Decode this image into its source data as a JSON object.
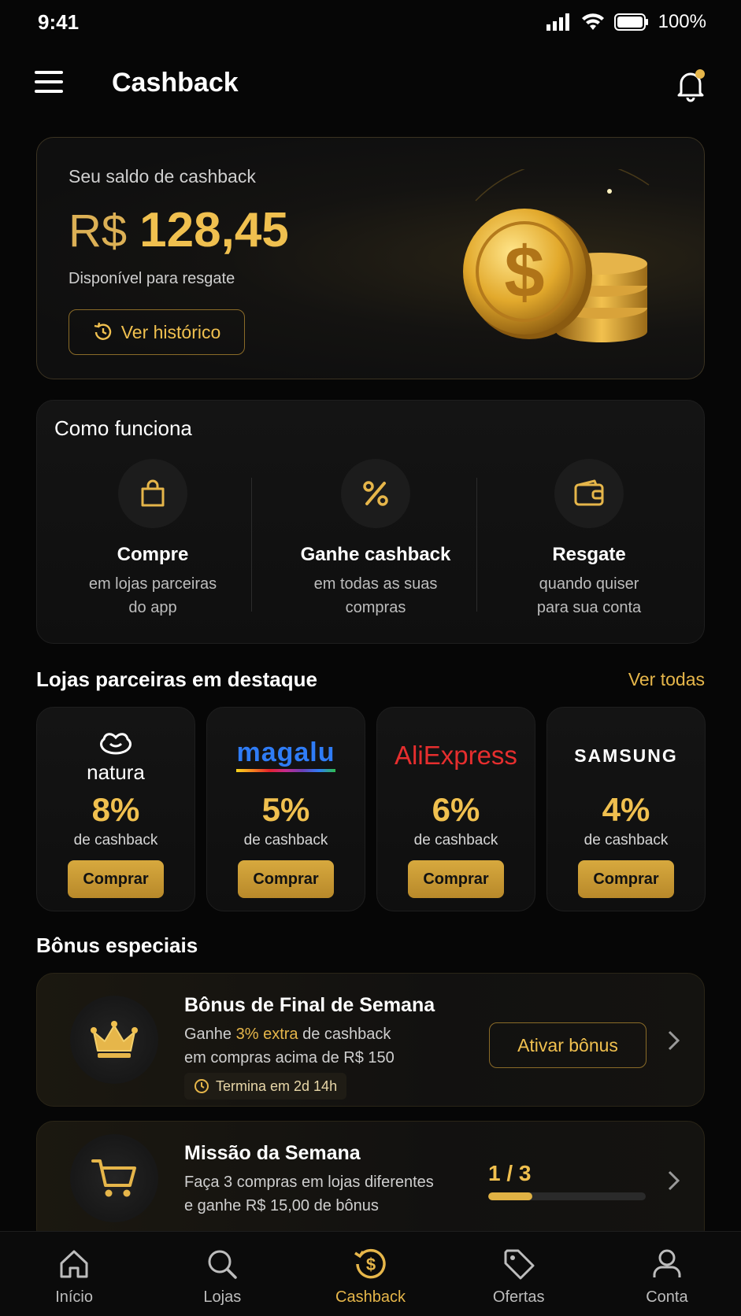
{
  "status_bar": {
    "time": "9:41",
    "battery": "100%"
  },
  "header": {
    "title": "Cashback"
  },
  "balance": {
    "label": "Seu saldo de cashback",
    "currency": "R$",
    "amount": "128,45",
    "subtitle": "Disponível para resgate",
    "history_button": "Ver histórico"
  },
  "how_it_works": {
    "title": "Como funciona",
    "steps": [
      {
        "icon": "shopping-bag-icon",
        "title": "Compre",
        "line1": "em lojas parceiras",
        "line2": "do app"
      },
      {
        "icon": "percent-icon",
        "title": "Ganhe cashback",
        "line1": "em todas as suas",
        "line2": "compras"
      },
      {
        "icon": "wallet-icon",
        "title": "Resgate",
        "line1": "quando quiser",
        "line2": "para sua conta"
      }
    ]
  },
  "stores": {
    "title": "Lojas parceiras em destaque",
    "see_all": "Ver todas",
    "items": [
      {
        "name": "natura",
        "percent": "8%",
        "subtitle": "de cashback",
        "button": "Comprar"
      },
      {
        "name": "magalu",
        "percent": "5%",
        "subtitle": "de cashback",
        "button": "Comprar"
      },
      {
        "name": "AliExpress",
        "percent": "6%",
        "subtitle": "de cashback",
        "button": "Comprar"
      },
      {
        "name": "SAMSUNG",
        "percent": "4%",
        "subtitle": "de cashback",
        "button": "Comprar"
      }
    ]
  },
  "bonus": {
    "title": "Bônus especiais",
    "weekend": {
      "title": "Bônus de Final de Semana",
      "desc_pre": "Ganhe ",
      "desc_highlight": "3% extra",
      "desc_post": " de cashback",
      "desc_line2": "em compras acima de R$ 150",
      "timer": "Termina em 2d 14h",
      "button": "Ativar bônus"
    },
    "mission": {
      "title": "Missão da Semana",
      "desc_line1": "Faça 3 compras em lojas diferentes",
      "desc_line2": "e ganhe R$ 15,00 de bônus",
      "progress_text": "1 / 3",
      "progress_fraction": 0.28
    }
  },
  "tabs": [
    {
      "label": "Início",
      "icon": "home-icon"
    },
    {
      "label": "Lojas",
      "icon": "search-icon"
    },
    {
      "label": "Cashback",
      "icon": "cashback-icon",
      "active": true
    },
    {
      "label": "Ofertas",
      "icon": "tag-icon"
    },
    {
      "label": "Conta",
      "icon": "user-icon"
    }
  ],
  "colors": {
    "accent": "#E6B64A",
    "background": "#060606",
    "card": "#121212"
  }
}
